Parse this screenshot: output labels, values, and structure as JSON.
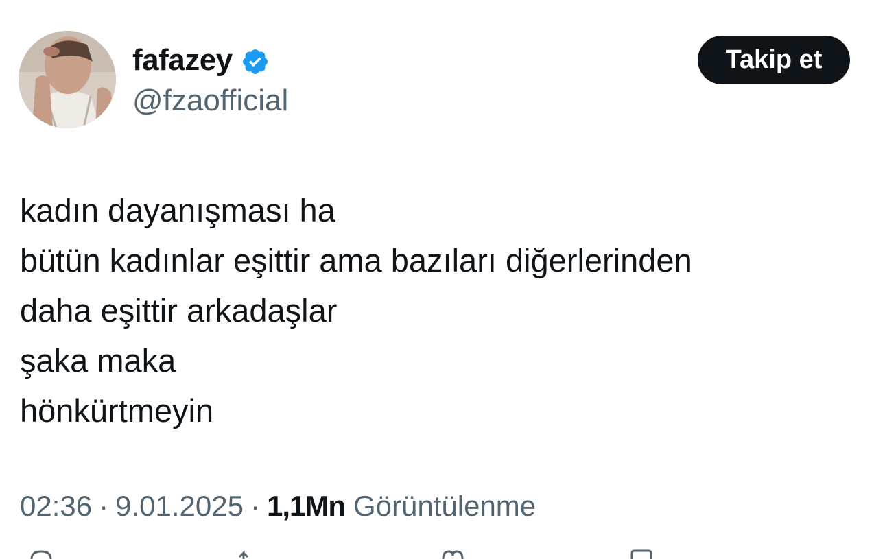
{
  "author": {
    "display_name": "fafazey",
    "handle": "@fzaofficial",
    "verified_icon": "verified-badge-icon",
    "verified_color": "#1d9bf0"
  },
  "follow_button": {
    "label": "Takip et"
  },
  "tweet": {
    "lines": [
      "kadın dayanışması ha",
      "bütün kadınlar eşittir ama bazıları diğerlerinden",
      "daha eşittir arkadaşlar",
      "şaka maka",
      "hönkürtmeyin"
    ]
  },
  "meta": {
    "time": "02:36",
    "separator": "·",
    "date": "9.01.2025",
    "views_count": "1,1Mn",
    "views_label": "Görüntülenme"
  },
  "action_icons": [
    "reply-icon",
    "retweet-icon",
    "like-icon",
    "bookmark-icon"
  ]
}
